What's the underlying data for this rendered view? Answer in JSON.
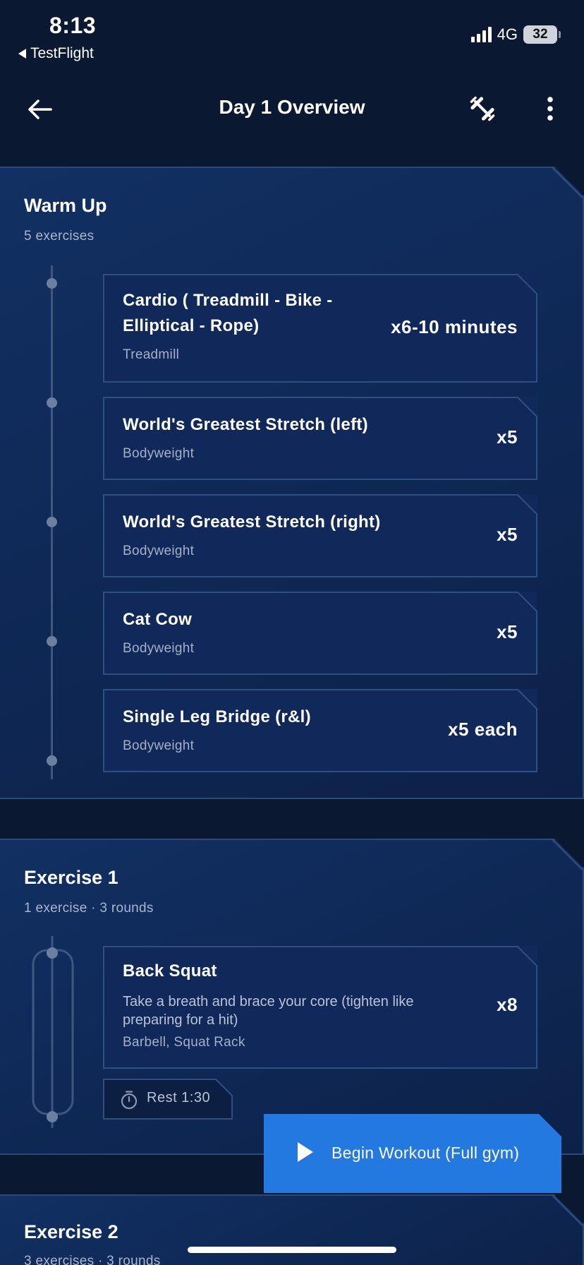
{
  "status_bar": {
    "time": "8:13",
    "back_app": "TestFlight",
    "network": "4G",
    "battery": "32"
  },
  "header": {
    "title": "Day 1 Overview",
    "back_icon": "arrow-left-icon",
    "equipment_icon": "dumbbell-icon",
    "menu_icon": "more-vertical-icon"
  },
  "sections": [
    {
      "title": "Warm Up",
      "subtitle": "5 exercises",
      "exercises": [
        {
          "name_line1": "Cardio ( Treadmill - Bike -",
          "name_line2": "Elliptical - Rope)",
          "equipment": "Treadmill",
          "reps": "x6-10 minutes"
        },
        {
          "name": "World's Greatest Stretch (left)",
          "equipment": "Bodyweight",
          "reps": "x5"
        },
        {
          "name": "World's Greatest Stretch (right)",
          "equipment": "Bodyweight",
          "reps": "x5"
        },
        {
          "name": "Cat Cow",
          "equipment": "Bodyweight",
          "reps": "x5"
        },
        {
          "name": "Single Leg Bridge (r&l)",
          "equipment": "Bodyweight",
          "reps": "x5 each"
        }
      ]
    },
    {
      "title": "Exercise 1",
      "subtitle": "1 exercise  ·  3 rounds",
      "exercises": [
        {
          "name": "Back Squat",
          "desc_line1": "Take a breath and brace your core (tighten like",
          "desc_line2": "preparing for a hit)",
          "equipment": "Barbell, Squat Rack",
          "reps": "x8"
        }
      ],
      "rest": "Rest 1:30"
    },
    {
      "title": "Exercise 2",
      "subtitle": "3 exercises  ·  3 rounds"
    }
  ],
  "cta": {
    "label": "Begin Workout (Full gym)",
    "icon": "play-icon",
    "color": "#2479e0"
  },
  "colors": {
    "background": "#0b1831",
    "card": "#11295a",
    "border": "#2a4a7b",
    "accent": "#2479e0"
  }
}
